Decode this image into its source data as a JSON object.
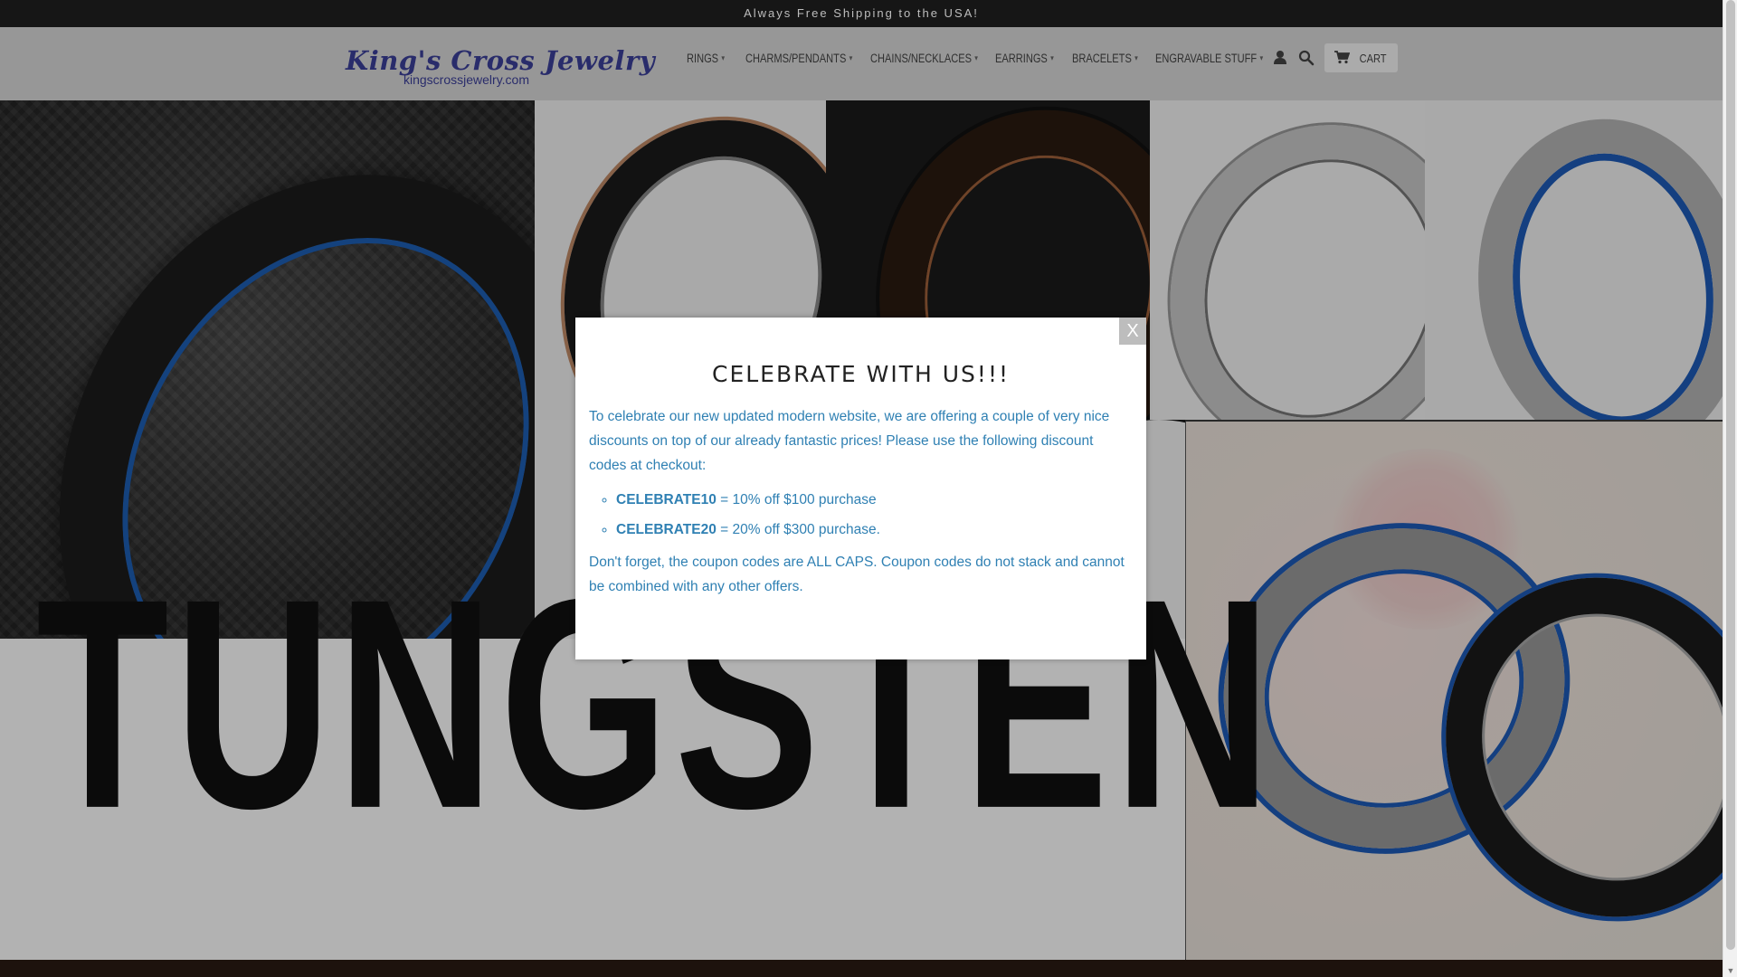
{
  "announcement": "Always Free Shipping to the USA!",
  "logo": {
    "name": "King's Cross Jewelry",
    "url_text": "kingscrossjewelry.com"
  },
  "nav": [
    {
      "label": "RINGS",
      "caret": "▾"
    },
    {
      "label": "CHARMS/PENDANTS",
      "caret": "▾"
    },
    {
      "label": "CHAINS/NECKLACES",
      "caret": "▾"
    },
    {
      "label": "EARRINGS",
      "caret": "▾"
    },
    {
      "label": "BRACELETS",
      "caret": "▾"
    },
    {
      "label": "ENGRAVABLE STUFF",
      "caret": "▾"
    }
  ],
  "icons": {
    "account": "user-icon",
    "search": "search-icon",
    "cart": "cart-icon"
  },
  "cart_label": "CART",
  "hero": {
    "word": "TUNGSTEN"
  },
  "modal": {
    "close_label": "X",
    "title": "CELEBRATE WITH US!!!",
    "intro": "To celebrate our new updated modern website, we are offering a couple of very nice discounts on top of our already fantastic prices! Please use the following discount codes at checkout:",
    "codes": [
      {
        "code": "CELEBRATE10",
        "desc": " = 10% off $100 purchase"
      },
      {
        "code": "CELEBRATE20",
        "desc": " = 20% off $300 purchase."
      }
    ],
    "footer": "Don't forget, the coupon codes are ALL CAPS. Coupon codes do not stack and cannot be combined with any other offers."
  },
  "colors": {
    "accent": "#2f80b3",
    "logo": "#3c3f9a",
    "topbar": "#161616"
  }
}
